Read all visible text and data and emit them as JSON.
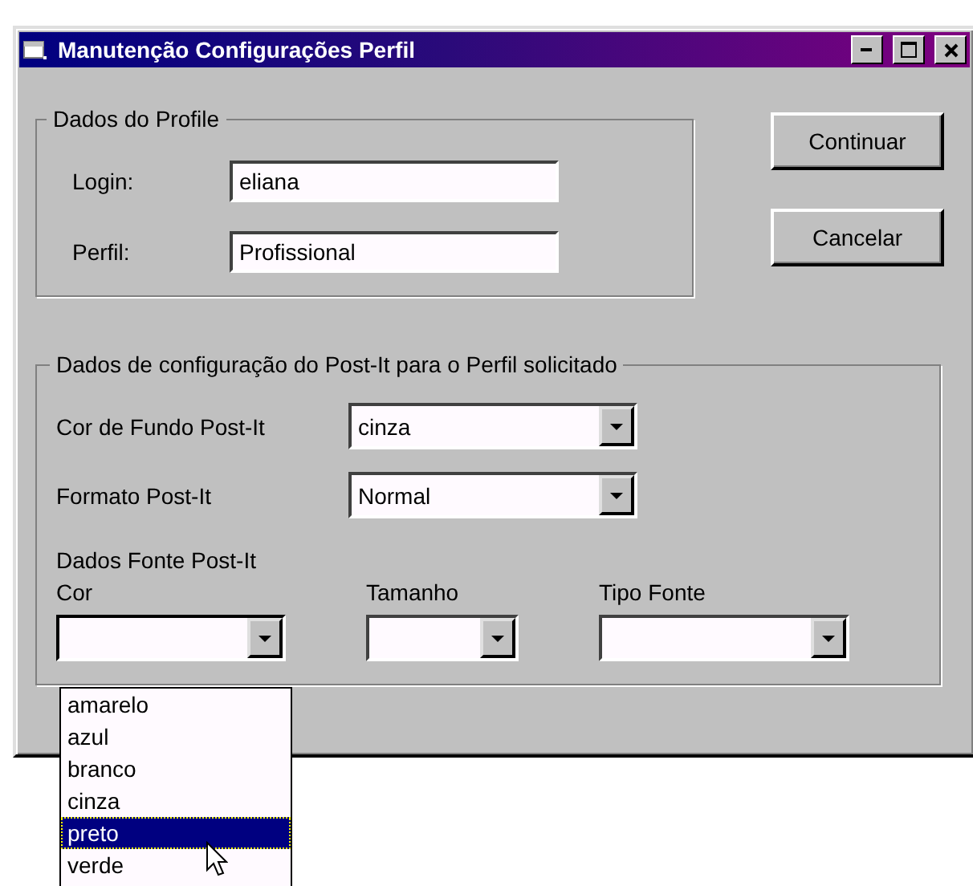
{
  "window": {
    "title": "Manutenção Configurações Perfil"
  },
  "profile_group": {
    "legend": "Dados do Profile",
    "fields": [
      {
        "label": "Login:",
        "value": "eliana"
      },
      {
        "label": "Perfil:",
        "value": "Profissional"
      }
    ]
  },
  "buttons": [
    "Continuar",
    "Cancelar"
  ],
  "config_group": {
    "legend": "Dados de configuração do Post-It para o Perfil solicitado",
    "combos": [
      {
        "label": "Cor de Fundo Post-It",
        "value": "cinza"
      },
      {
        "label": "Formato Post-It",
        "value": "Normal"
      }
    ],
    "font_heading": "Dados Fonte Post-It",
    "font_combos": [
      {
        "label": "Cor",
        "open": true
      },
      {
        "label": "Tamanho",
        "open": false
      },
      {
        "label": "Tipo Fonte",
        "open": false
      }
    ]
  },
  "dropdown": {
    "items": [
      {
        "label": "amarelo",
        "selected": false
      },
      {
        "label": "azul",
        "selected": false
      },
      {
        "label": "branco",
        "selected": false
      },
      {
        "label": "cinza",
        "selected": false
      },
      {
        "label": "preto",
        "selected": true
      },
      {
        "label": "verde",
        "selected": false
      }
    ]
  }
}
